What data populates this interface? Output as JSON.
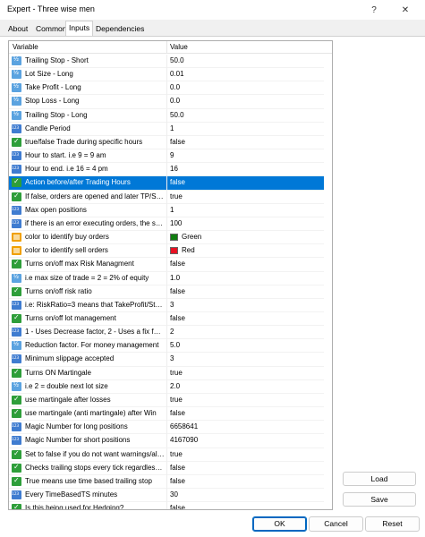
{
  "window": {
    "title": "Expert - Three wise men",
    "help_icon": "?",
    "close_icon": "✕"
  },
  "tabs": [
    {
      "label": "About"
    },
    {
      "label": "Common"
    },
    {
      "label": "Inputs"
    },
    {
      "label": "Dependencies"
    }
  ],
  "grid": {
    "header_variable": "Variable",
    "header_value": "Value",
    "rows": [
      {
        "icon": "double-icon",
        "name": "Trailing Stop - Short",
        "value": "50.0"
      },
      {
        "icon": "double-icon",
        "name": "Lot Size - Long",
        "value": "0.01"
      },
      {
        "icon": "double-icon",
        "name": "Take Profit - Long",
        "value": "0.0"
      },
      {
        "icon": "double-icon",
        "name": "Stop Loss - Long",
        "value": "0.0"
      },
      {
        "icon": "double-icon",
        "name": "Trailing Stop - Long",
        "value": "50.0"
      },
      {
        "icon": "integer-icon",
        "name": "Candle Period",
        "value": "1"
      },
      {
        "icon": "bool-icon",
        "name": "true/false Trade during specific hours",
        "value": "false"
      },
      {
        "icon": "integer-icon",
        "name": "Hour to start. i.e 9 = 9 am",
        "value": "9"
      },
      {
        "icon": "integer-icon",
        "name": "Hour to end. i.e 16 = 4 pm",
        "value": "16"
      },
      {
        "icon": "bool-icon",
        "name": "Action before/after Trading Hours",
        "value": "false"
      },
      {
        "icon": "bool-icon",
        "name": "If false, orders are opened and later TP/SL...",
        "value": "true"
      },
      {
        "icon": "integer-icon",
        "name": "Max open positions",
        "value": "1"
      },
      {
        "icon": "integer-icon",
        "name": "if there is an error executing orders, the scri...",
        "value": "100"
      },
      {
        "icon": "color-icon",
        "name": "color to identify buy orders",
        "value": "Green",
        "swatch": "#107c10"
      },
      {
        "icon": "color-icon",
        "name": "color to identify sell orders",
        "value": "Red",
        "swatch": "#e81123"
      },
      {
        "icon": "bool-icon",
        "name": "Turns on/off max Risk Managment",
        "value": "false"
      },
      {
        "icon": "double-icon",
        "name": "i.e max size of trade = 2 = 2% of equity",
        "value": "1.0"
      },
      {
        "icon": "bool-icon",
        "name": "Turns on/off risk ratio",
        "value": "false"
      },
      {
        "icon": "integer-icon",
        "name": "i.e: RiskRatio=3 means that TakeProfit/Sto...",
        "value": "3"
      },
      {
        "icon": "bool-icon",
        "name": "Turns on/off lot management",
        "value": "false"
      },
      {
        "icon": "integer-icon",
        "name": "1 - Uses Decrease factor, 2 - Uses a fix fact...",
        "value": "2"
      },
      {
        "icon": "double-icon",
        "name": "Reduction factor. For money management",
        "value": "5.0"
      },
      {
        "icon": "integer-icon",
        "name": "Minimum slippage accepted",
        "value": "3"
      },
      {
        "icon": "bool-icon",
        "name": "Turns ON Martingale",
        "value": "true"
      },
      {
        "icon": "double-icon",
        "name": "i.e 2 = double next lot size",
        "value": "2.0"
      },
      {
        "icon": "bool-icon",
        "name": "use martingale after losses",
        "value": "true"
      },
      {
        "icon": "bool-icon",
        "name": "use martingale (anti martingale) after Win",
        "value": "false"
      },
      {
        "icon": "integer-icon",
        "name": "Magic Number for long positions",
        "value": "6658641"
      },
      {
        "icon": "integer-icon",
        "name": "Magic Number for short positions",
        "value": "4167090"
      },
      {
        "icon": "bool-icon",
        "name": "Set to false if you do not want warnings/alerts",
        "value": "true"
      },
      {
        "icon": "bool-icon",
        "name": "Checks trailing stops every tick regardless ...",
        "value": "false"
      },
      {
        "icon": "bool-icon",
        "name": "True means use time based trailing stop",
        "value": "false"
      },
      {
        "icon": "integer-icon",
        "name": "Every TimeBasedTS minutes",
        "value": "30"
      },
      {
        "icon": "bool-icon",
        "name": "Is this being used for Hedging?",
        "value": "false"
      }
    ],
    "selected_index": 9
  },
  "buttons": {
    "load": "Load",
    "save": "Save",
    "ok": "OK",
    "cancel": "Cancel",
    "reset": "Reset"
  }
}
